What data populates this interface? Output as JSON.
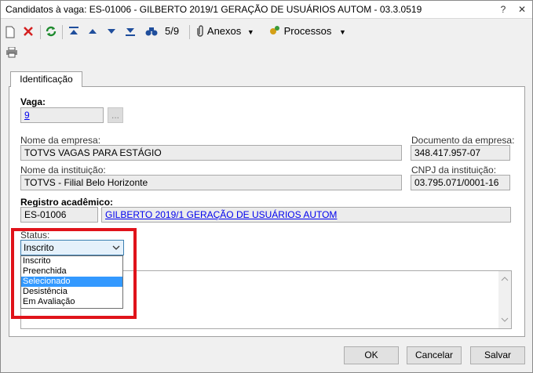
{
  "window": {
    "title": "Candidatos à vaga: ES-01006 - GILBERTO 2019/1 GERAÇÃO DE USUÁRIOS AUTOM - 03.3.0519",
    "help_label": "?",
    "close_label": "✕"
  },
  "toolbar": {
    "record_position": "5/9",
    "attachments_label": "Anexos",
    "processes_label": "Processos"
  },
  "tab": {
    "label": "Identificação"
  },
  "form": {
    "vaga_label": "Vaga:",
    "vaga_value": "9",
    "vaga_lookup_label": "...",
    "company_name_label": "Nome da empresa:",
    "company_name_value": "TOTVS VAGAS PARA ESTÁGIO",
    "company_doc_label": "Documento da empresa:",
    "company_doc_value": "348.417.957-07",
    "institution_name_label": "Nome da instituição:",
    "institution_name_value": "TOTVS - Filial Belo Horizonte",
    "institution_cnpj_label": "CNPJ da instituição:",
    "institution_cnpj_value": "03.795.071/0001-16",
    "academic_record_label": "Registro acadêmico:",
    "academic_record_code": "ES-01006",
    "academic_record_name": "GILBERTO 2019/1 GERAÇÃO DE USUÁRIOS AUTOM",
    "status_label": "Status:",
    "status_value": "Inscrito",
    "status_options": [
      "Inscrito",
      "Preenchida",
      "Selecionado",
      "Desistência",
      "Em Avaliação"
    ],
    "status_highlighted_option": "Selecionado"
  },
  "buttons": {
    "ok": "OK",
    "cancel": "Cancelar",
    "save": "Salvar"
  },
  "colors": {
    "link": "#0000ee",
    "selection": "#3399ff",
    "highlight_frame": "#e0131a"
  }
}
